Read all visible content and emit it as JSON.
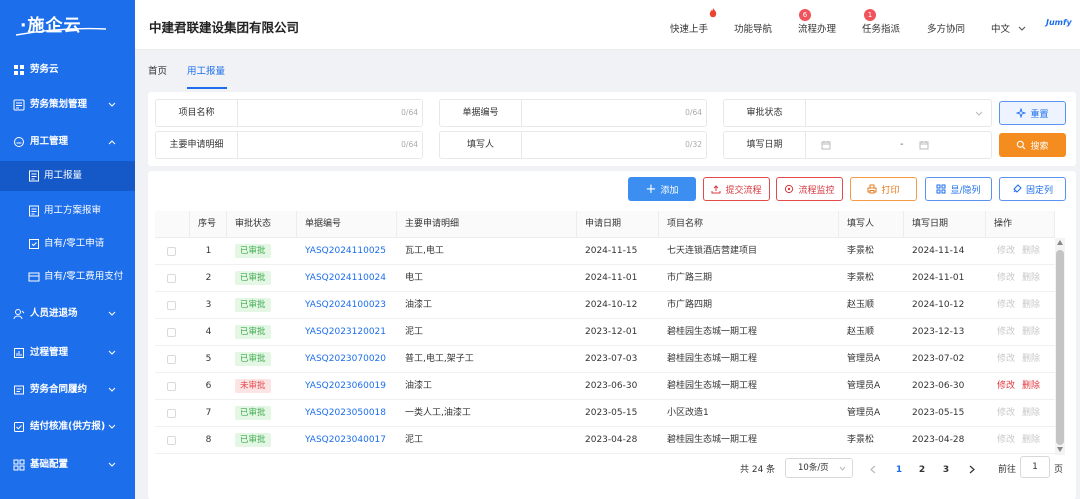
{
  "app": {
    "logo_text": "·施企云"
  },
  "sidebar": {
    "items": [
      {
        "label": "劳务云",
        "icon": "grid-icon",
        "level": 0,
        "expandable": false,
        "active": false
      },
      {
        "label": "劳务策划管理",
        "icon": "plan-icon",
        "level": 0,
        "expandable": true,
        "expanded": false
      },
      {
        "label": "用工管理",
        "icon": "worker-icon",
        "level": 0,
        "expandable": true,
        "expanded": true
      },
      {
        "label": "用工报量",
        "icon": "report-icon",
        "level": 1,
        "active": true
      },
      {
        "label": "用工方案报审",
        "icon": "report-icon",
        "level": 1
      },
      {
        "label": "自有/零工申请",
        "icon": "apply-icon",
        "level": 1
      },
      {
        "label": "自有/零工费用支付",
        "icon": "payment-icon",
        "level": 1
      },
      {
        "label": "人员进退场",
        "icon": "person-icon",
        "level": 0,
        "expandable": true,
        "expanded": false
      },
      {
        "label": "过程管理",
        "icon": "process-icon",
        "level": 0,
        "expandable": true,
        "expanded": false
      },
      {
        "label": "劳务合同履约",
        "icon": "contract-icon",
        "level": 0,
        "expandable": true,
        "expanded": false
      },
      {
        "label": "结付核准(供方报)",
        "icon": "approve-icon",
        "level": 0,
        "expandable": true,
        "expanded": false
      },
      {
        "label": "基础配置",
        "icon": "config-icon",
        "level": 0,
        "expandable": true,
        "expanded": false
      }
    ]
  },
  "header": {
    "company": "中建君联建设集团有限公司",
    "nav": [
      {
        "label": "快速上手",
        "badge": "",
        "hot": true
      },
      {
        "label": "功能导航",
        "badge": ""
      },
      {
        "label": "流程办理",
        "badge": "6"
      },
      {
        "label": "任务指派",
        "badge": "1"
      },
      {
        "label": "多方协同",
        "badge": ""
      }
    ],
    "language": "中文",
    "hot_label": "HOT",
    "brand": "Jumfy"
  },
  "tabs": [
    {
      "label": "首页",
      "active": false
    },
    {
      "label": "用工报量",
      "active": true
    }
  ],
  "filters": {
    "project_name": {
      "label": "项目名称",
      "value": "",
      "count": "0/64"
    },
    "bill_no": {
      "label": "单据编号",
      "value": "",
      "count": "0/64"
    },
    "approval_status": {
      "label": "审批状态",
      "value": ""
    },
    "main_detail": {
      "label": "主要申请明细",
      "value": "",
      "count": "0/64"
    },
    "filler": {
      "label": "填写人",
      "value": "",
      "count": "0/32"
    },
    "fill_date": {
      "label": "填写日期",
      "start": "",
      "end": "",
      "sep": "-"
    },
    "reset_label": "重置",
    "search_label": "搜索"
  },
  "toolbar": {
    "add": "添加",
    "submit_flow": "提交流程",
    "monitor_flow": "流程监控",
    "print": "打印",
    "toggle_columns": "显/隐列",
    "fix_columns": "固定列"
  },
  "table": {
    "columns": [
      "序号",
      "审批状态",
      "单据编号",
      "主要申请明细",
      "申请日期",
      "项目名称",
      "填写人",
      "填写日期",
      "操作"
    ],
    "rows": [
      {
        "no": "1",
        "status": "已审批",
        "approved": true,
        "bill": "YASQ2024110025",
        "detail": "瓦工,电工",
        "apply_date": "2024-11-15",
        "project": "七天连锁酒店营建项目",
        "filler": "李景松",
        "fill_date": "2024-11-14"
      },
      {
        "no": "2",
        "status": "已审批",
        "approved": true,
        "bill": "YASQ2024110024",
        "detail": "电工",
        "apply_date": "2024-11-01",
        "project": "市广路三期",
        "filler": "李景松",
        "fill_date": "2024-11-01"
      },
      {
        "no": "3",
        "status": "已审批",
        "approved": true,
        "bill": "YASQ2024100023",
        "detail": "油漆工",
        "apply_date": "2024-10-12",
        "project": "市广路四期",
        "filler": "赵玉顺",
        "fill_date": "2024-10-12"
      },
      {
        "no": "4",
        "status": "已审批",
        "approved": true,
        "bill": "YASQ2023120021",
        "detail": "泥工",
        "apply_date": "2023-12-01",
        "project": "碧桂园生态城一期工程",
        "filler": "赵玉顺",
        "fill_date": "2023-12-13"
      },
      {
        "no": "5",
        "status": "已审批",
        "approved": true,
        "bill": "YASQ2023070020",
        "detail": "普工,电工,架子工",
        "apply_date": "2023-07-03",
        "project": "碧桂园生态城一期工程",
        "filler": "管理员A",
        "fill_date": "2023-07-02"
      },
      {
        "no": "6",
        "status": "未审批",
        "approved": false,
        "bill": "YASQ2023060019",
        "detail": "油漆工",
        "apply_date": "2023-06-30",
        "project": "碧桂园生态城一期工程",
        "filler": "管理员A",
        "fill_date": "2023-06-30"
      },
      {
        "no": "7",
        "status": "已审批",
        "approved": true,
        "bill": "YASQ2023050018",
        "detail": "一类人工,油漆工",
        "apply_date": "2023-05-15",
        "project": "小区改造1",
        "filler": "管理员A",
        "fill_date": "2023-05-15"
      },
      {
        "no": "8",
        "status": "已审批",
        "approved": true,
        "bill": "YASQ2023040017",
        "detail": "泥工",
        "apply_date": "2023-04-28",
        "project": "碧桂园生态城一期工程",
        "filler": "李景松",
        "fill_date": "2023-04-28"
      }
    ],
    "op_edit": "修改",
    "op_delete": "删除"
  },
  "pagination": {
    "total": "共 24 条",
    "page_size": "10条/页",
    "pages": [
      "1",
      "2",
      "3"
    ],
    "current": "1",
    "goto_label": "前往",
    "goto_value": "1",
    "page_unit": "页"
  },
  "colors": {
    "primary": "#1c6eeb",
    "sidebar": "#1c6eeb",
    "search": "#f58c1f",
    "danger": "#e0383e",
    "success": "#3daa4d"
  }
}
